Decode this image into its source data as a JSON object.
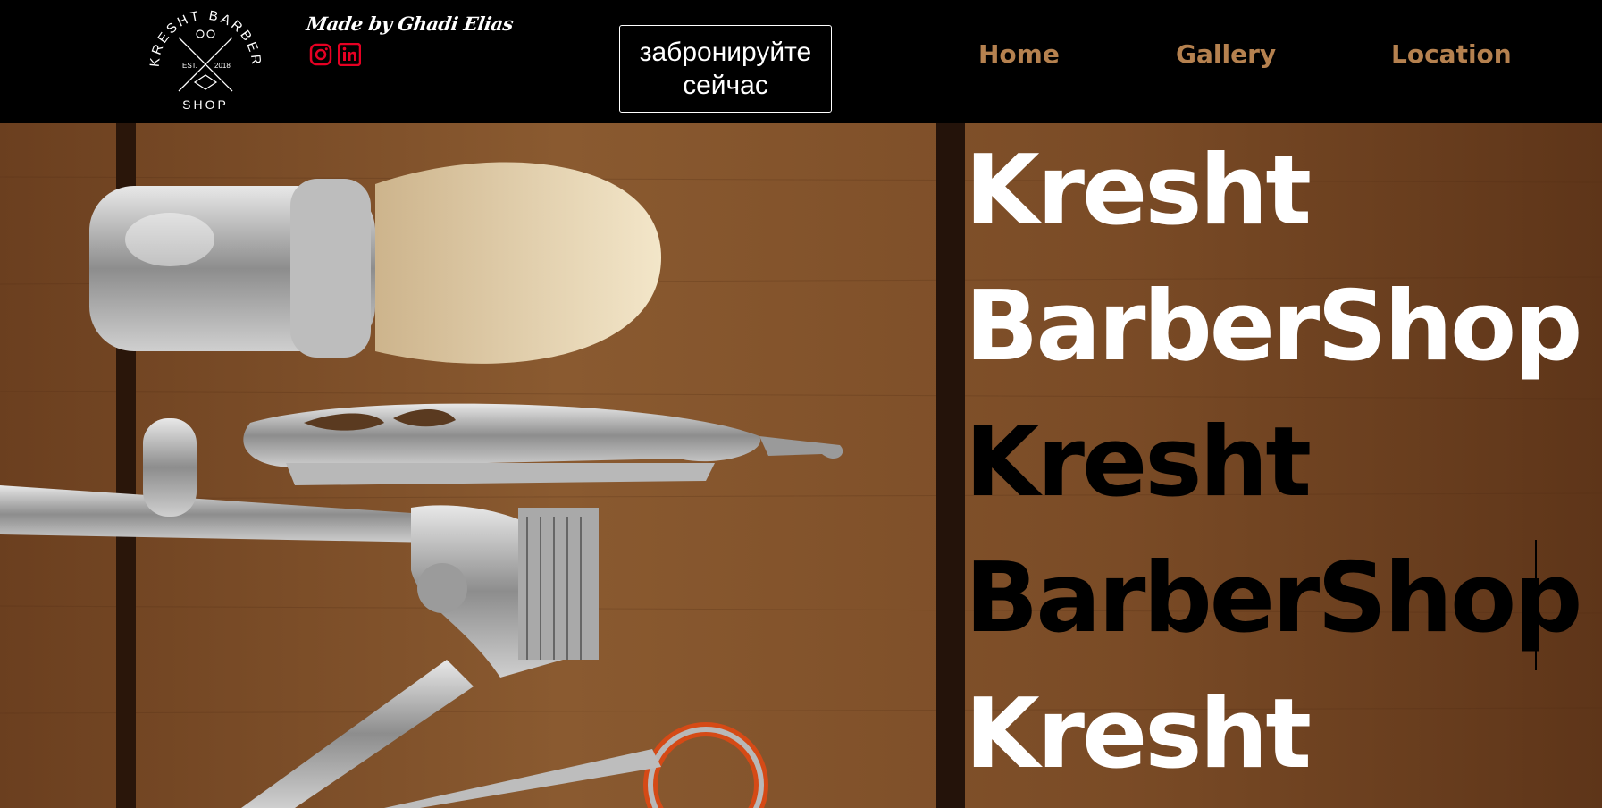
{
  "header": {
    "logo": {
      "top_text": "KRESHT BARBER",
      "est": "EST.",
      "year": "2018",
      "bottom_text": "SHOP"
    },
    "credit": "Made by Ghadi Elias",
    "socials": [
      {
        "name": "instagram-icon",
        "color": "#e60023"
      },
      {
        "name": "linkedin-icon",
        "color": "#e60023"
      }
    ],
    "book_button": "забронируйте сейчас",
    "nav": {
      "home": "Home",
      "gallery": "Gallery",
      "location": "Location"
    },
    "nav_color": "#b5814f"
  },
  "hero": {
    "lines": [
      "Kresht",
      "BarberShop",
      "Kresht",
      "BarberShop",
      "Kresht"
    ]
  },
  "colors": {
    "wood": "#7a4a24",
    "accent_red": "#e60023"
  }
}
